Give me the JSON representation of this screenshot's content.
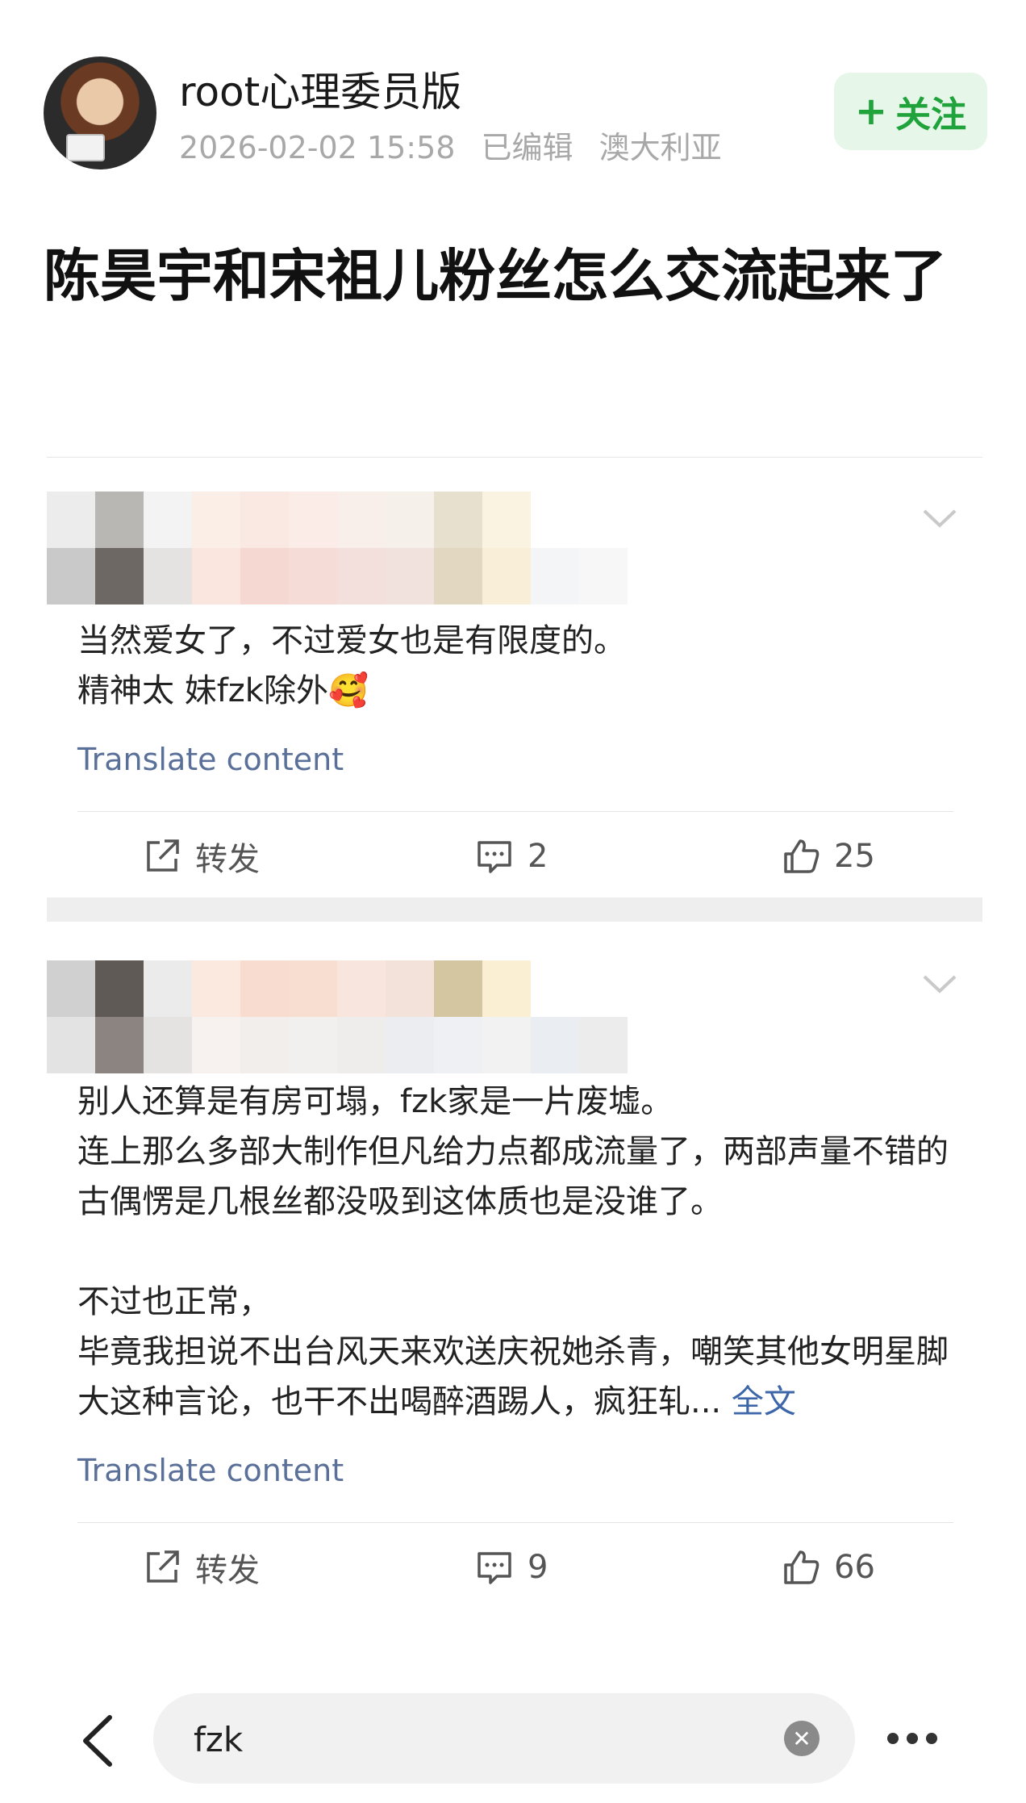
{
  "post": {
    "author": "root心理委员版",
    "date": "2026-02-02 15:58",
    "edited": "已编辑",
    "location": "澳大利亚",
    "follow_label": "关注",
    "title": "陈昊宇和宋祖儿粉丝怎么交流起来了"
  },
  "comments": [
    {
      "text": "当然爱女了，不过爱女也是有限度的。\n精神太 妹fzk除外🥰",
      "more": "",
      "translate": "Translate content",
      "repost_label": "转发",
      "comments_count": "2",
      "likes_count": "25"
    },
    {
      "text": "别人还算是有房可塌，fzk家是一片废墟。\n连上那么多部大制作但凡给力点都成流量了，两部声量不错的古偶愣是几根丝都没吸到这体质也是没谁了。\n\n不过也正常，\n毕竟我担说不出台风天来欢送庆祝她杀青，嘲笑其他女明星脚大这种言论，也干不出喝醉酒踢人，疯狂轧... ",
      "more": "全文",
      "translate": "Translate content",
      "repost_label": "转发",
      "comments_count": "9",
      "likes_count": "66"
    }
  ],
  "search": {
    "value": "fzk"
  },
  "colors": {
    "follow_green": "#1fa33a",
    "follow_bg": "#e6f6e9",
    "link_blue": "#3c66a8",
    "translate_blue": "#5a7099"
  },
  "icons": [
    "back-arrow-icon",
    "clear-icon",
    "more-dots-icon",
    "repost-icon",
    "comment-icon",
    "like-icon",
    "chevron-down-icon"
  ]
}
